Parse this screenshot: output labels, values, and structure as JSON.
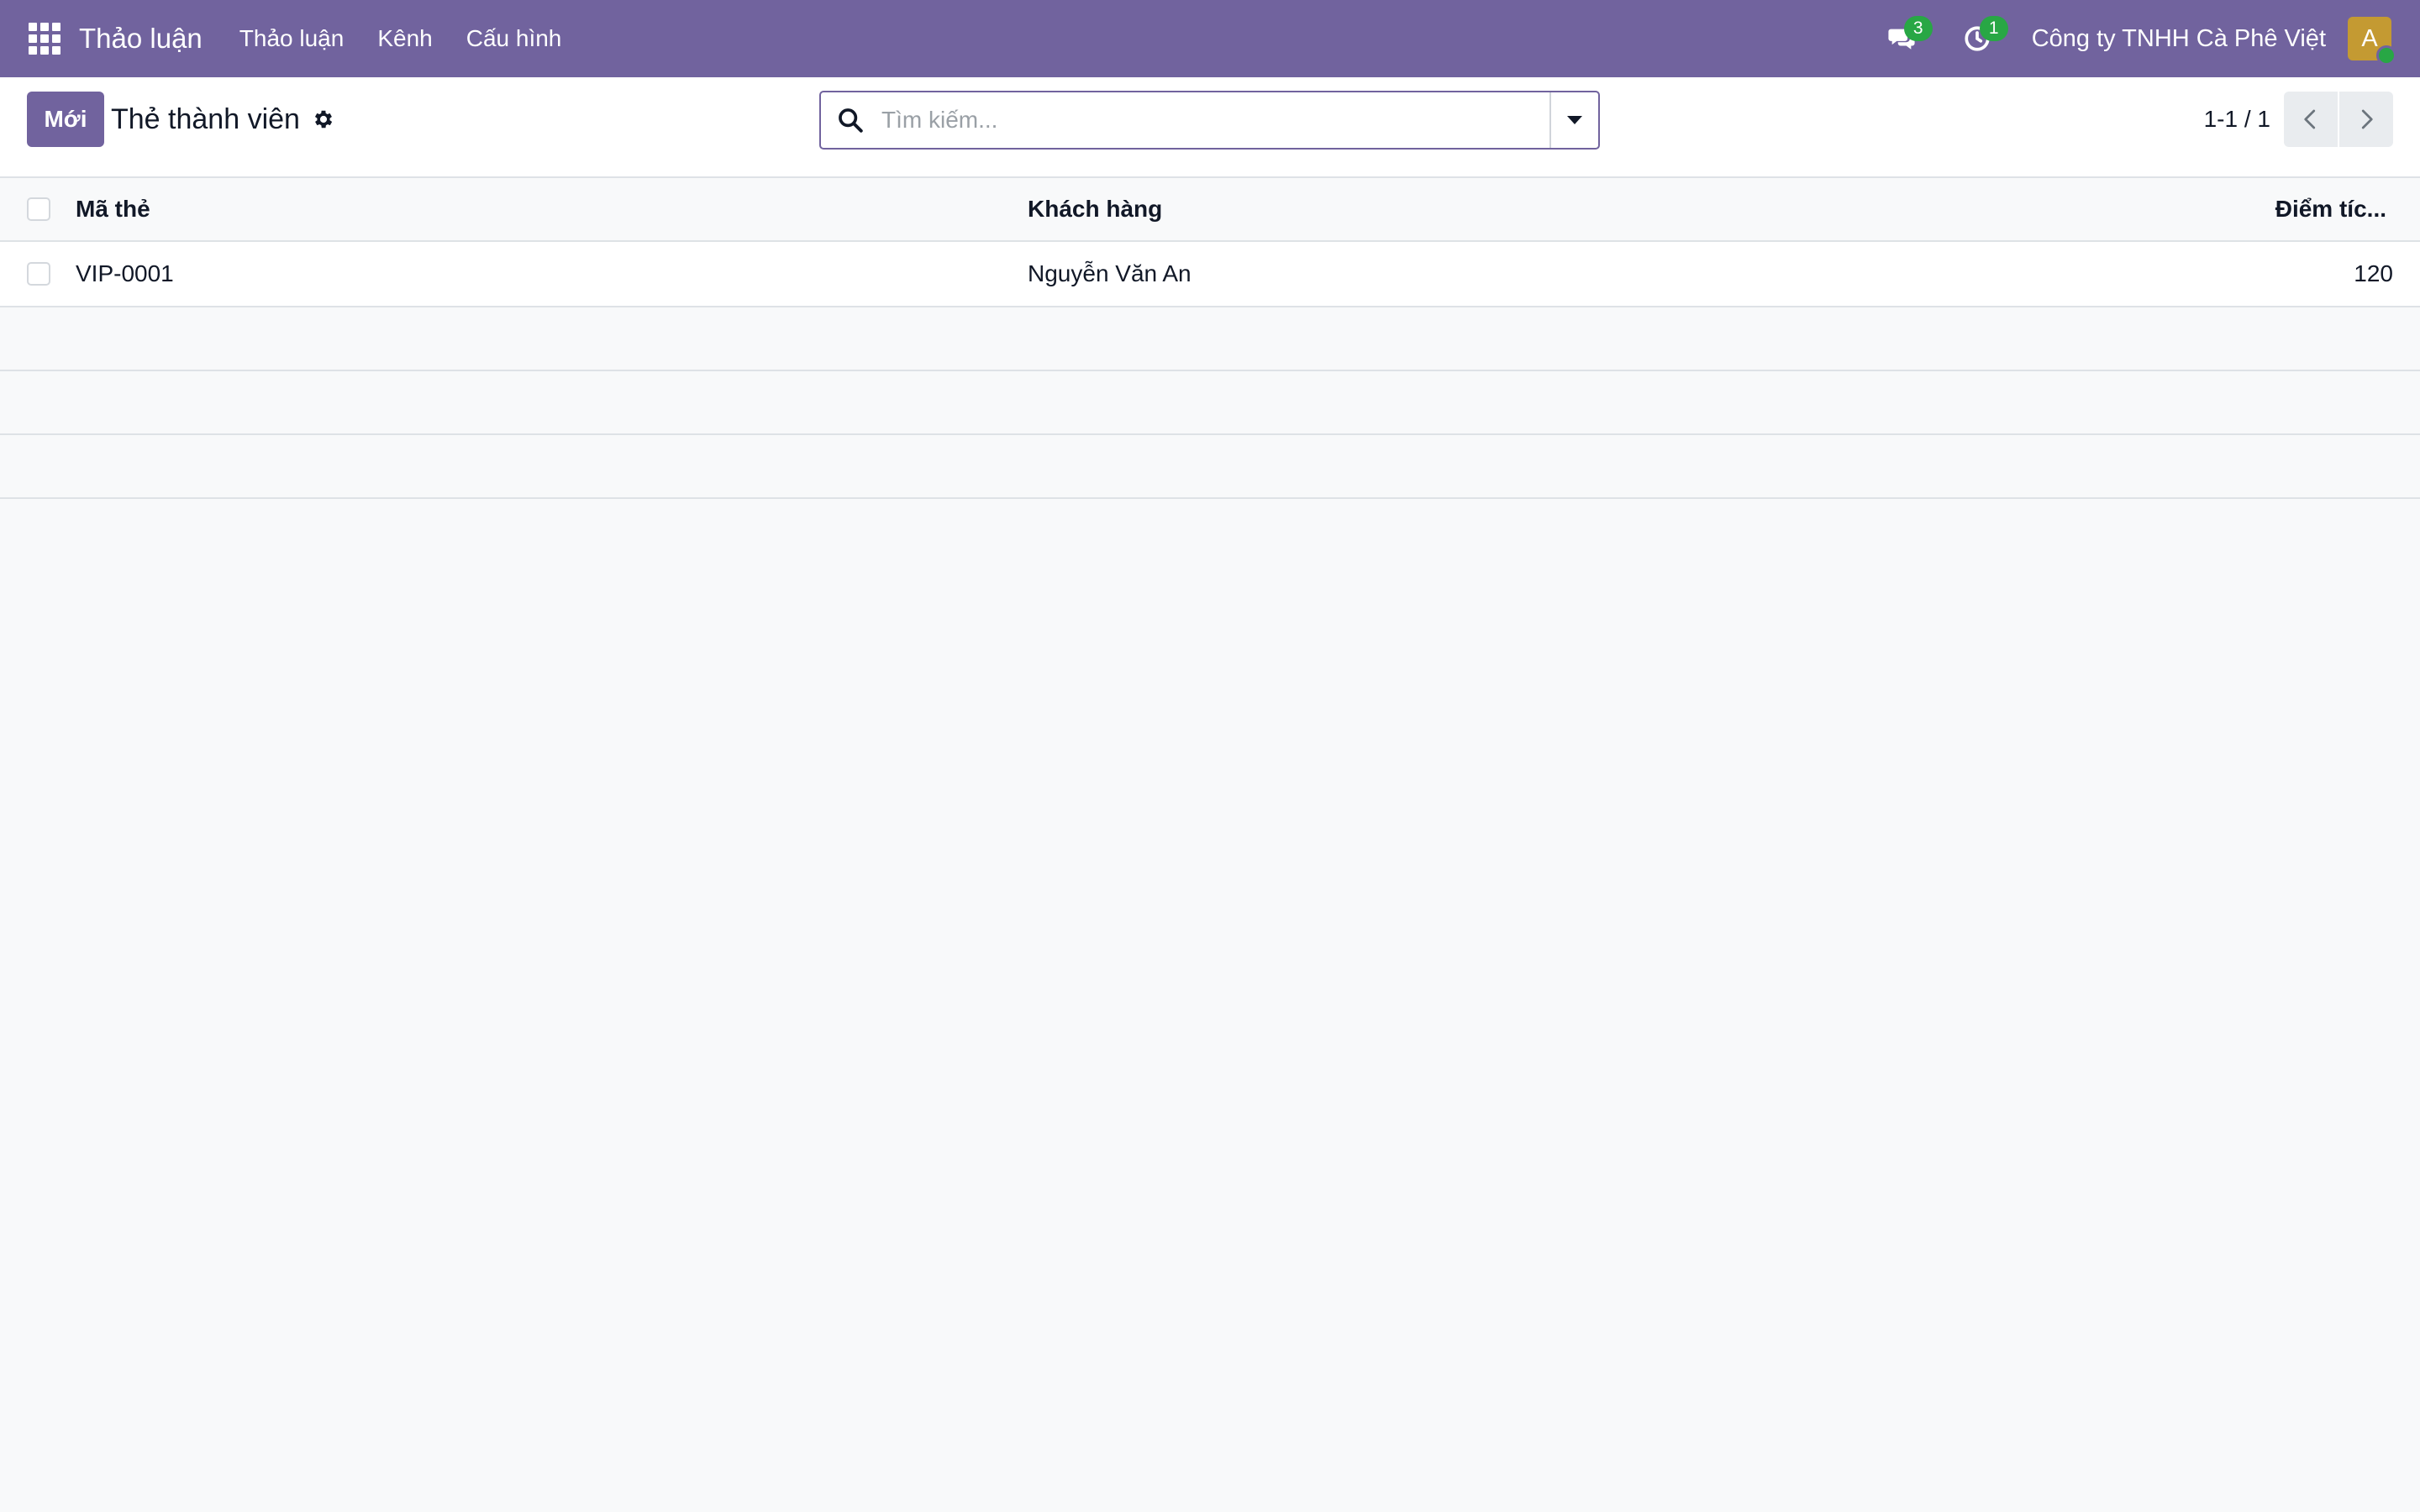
{
  "navbar": {
    "brand": "Thảo luận",
    "menu": [
      "Thảo luận",
      "Kênh",
      "Cấu hình"
    ],
    "messages_badge": "3",
    "activities_badge": "1",
    "company": "Công ty TNHH Cà Phê Việt",
    "avatar_initial": "A",
    "accent_color": "#71639e",
    "badge_color": "#28a745"
  },
  "control_panel": {
    "new_button": "Mới",
    "title": "Thẻ thành viên",
    "search_placeholder": "Tìm kiếm...",
    "pager_value": "1-1 / 1"
  },
  "table": {
    "columns": [
      "Mã thẻ",
      "Khách hàng",
      "Điểm tíc..."
    ],
    "rows": [
      {
        "code": "VIP-0001",
        "customer": "Nguyễn Văn An",
        "points": "120"
      }
    ]
  }
}
